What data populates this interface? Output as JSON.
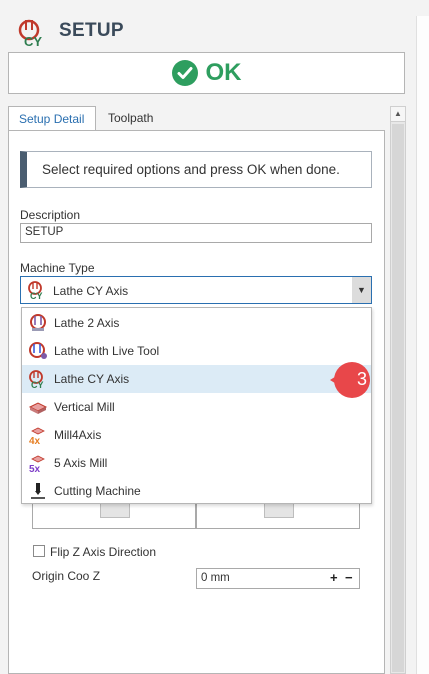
{
  "header": {
    "title": "SETUP"
  },
  "ok_button": {
    "label": "OK"
  },
  "tabs": [
    {
      "label": "Setup Detail"
    },
    {
      "label": "Toolpath"
    }
  ],
  "hint": "Select required options and press OK when done.",
  "description": {
    "label": "Description",
    "value": "SETUP"
  },
  "machine_type": {
    "label": "Machine Type",
    "selected": "Lathe CY Axis",
    "options": [
      {
        "label": "Lathe 2 Axis",
        "icon": "lathe-2-axis-icon"
      },
      {
        "label": "Lathe with Live Tool",
        "icon": "lathe-live-tool-icon"
      },
      {
        "label": "Lathe CY Axis",
        "icon": "lathe-cy-axis-icon"
      },
      {
        "label": "Vertical Mill",
        "icon": "vertical-mill-icon"
      },
      {
        "label": "Mill4Axis",
        "icon": "mill-4-axis-icon"
      },
      {
        "label": "5 Axis Mill",
        "icon": "mill-5-axis-icon"
      },
      {
        "label": "Cutting Machine",
        "icon": "cutting-machine-icon"
      }
    ]
  },
  "flip_z": {
    "label": "Flip Z Axis Direction",
    "checked": false
  },
  "origin_z": {
    "label": "Origin Coo Z",
    "value": "0 mm",
    "plus": "+",
    "minus": "−"
  },
  "callout": {
    "number": "3"
  },
  "colors": {
    "accent": "#2a6fb0",
    "ok_green": "#2e9e5f",
    "callout_red": "#e8474a"
  }
}
